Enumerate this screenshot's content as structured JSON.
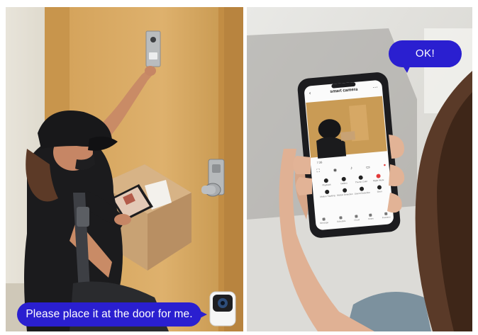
{
  "left_bubble": {
    "text": "Please place it at the door for me."
  },
  "right_bubble": {
    "text": "OK!"
  },
  "phone_app": {
    "title": "smart camera",
    "timestamp": "7:38",
    "grid_items": [
      {
        "label": "Playback",
        "icon": "playback-icon"
      },
      {
        "label": "Gallery",
        "icon": "gallery-icon"
      },
      {
        "label": "Theme Color",
        "icon": "palette-icon"
      },
      {
        "label": "Night Mode",
        "icon": "night-mode-icon"
      },
      {
        "label": "Motion Tracking",
        "icon": "motion-icon"
      },
      {
        "label": "Motion Detection",
        "icon": "detection-icon"
      },
      {
        "label": "Sound Detection",
        "icon": "sound-icon"
      },
      {
        "label": "Siren",
        "icon": "siren-icon"
      }
    ],
    "tabs": [
      "Message",
      "Schedule",
      "Cloud",
      "Share",
      "Features"
    ]
  },
  "colors": {
    "bubble": "#2a1fd0",
    "door": "#d9a95f",
    "wall": "#e6e2d6"
  }
}
